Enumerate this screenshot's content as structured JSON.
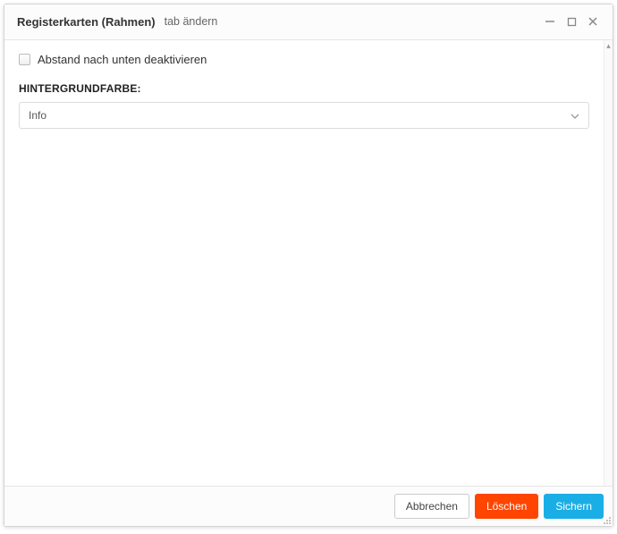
{
  "header": {
    "title": "Registerkarten (Rahmen)",
    "subtitle": "tab ändern"
  },
  "form": {
    "checkbox_label": "Abstand nach unten deaktivieren",
    "section_label": "HINTERGRUNDFARBE:",
    "select_value": "Info"
  },
  "footer": {
    "cancel": "Abbrechen",
    "delete": "Löschen",
    "save": "Sichern"
  }
}
